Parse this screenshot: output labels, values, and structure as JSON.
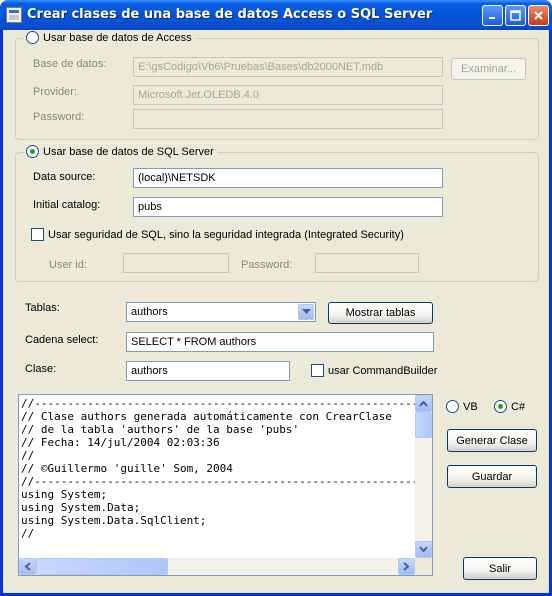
{
  "window": {
    "title": "Crear clases de una base de datos Access o SQL Server"
  },
  "access": {
    "radio_label": "Usar base de datos de Access",
    "selected": false,
    "base_label": "Base de datos:",
    "base_value": "E:\\gsCodigo\\Vb6\\Pruebas\\Bases\\db2000NET.mdb",
    "examinar_label": "Examinar...",
    "provider_label": "Provider:",
    "provider_value": "Microsoft.Jet.OLEDB.4.0",
    "password_label": "Password:",
    "password_value": ""
  },
  "sql": {
    "radio_label": "Usar base de datos de SQL Server",
    "selected": true,
    "datasource_label": "Data source:",
    "datasource_value": "(local)\\NETSDK",
    "catalog_label": "Initial catalog:",
    "catalog_value": "pubs",
    "security_label": "Usar seguridad de SQL, sino la seguridad integrada (Integrated Security)",
    "security_checked": false,
    "userid_label": "User id:",
    "userid_value": "",
    "password_label": "Password:",
    "password_value": ""
  },
  "tablas": {
    "label": "Tablas:",
    "selected": "authors",
    "mostrar_label": "Mostrar tablas"
  },
  "select": {
    "label": "Cadena select:",
    "value": "SELECT * FROM authors"
  },
  "clase": {
    "label": "Clase:",
    "value": "authors",
    "commandbuilder_label": "usar CommandBuilder",
    "commandbuilder_checked": false
  },
  "language": {
    "vb_label": "VB",
    "cs_label": "C#",
    "selected": "C#"
  },
  "buttons": {
    "generar": "Generar Clase",
    "guardar": "Guardar",
    "salir": "Salir"
  },
  "code_lines": [
    "//-----------------------------------------------------------------",
    "// Clase authors generada automáticamente con CrearClase",
    "// de la tabla 'authors' de la base 'pubs'",
    "// Fecha: 14/jul/2004 02:03:36",
    "//",
    "// ©Guillermo 'guille' Som, 2004",
    "//-----------------------------------------------------------------",
    "using System;",
    "using System.Data;",
    "using System.Data.SqlClient;",
    "//"
  ],
  "colors": {
    "titlebar": "#0453d6",
    "face": "#ece9d8",
    "field_border": "#7f9db9",
    "accent_green": "#21a121"
  }
}
